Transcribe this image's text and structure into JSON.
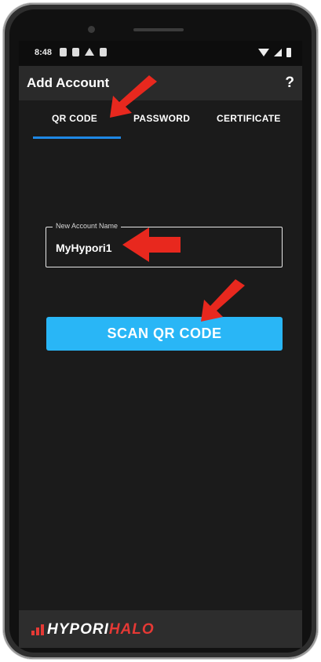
{
  "status_bar": {
    "time": "8:48"
  },
  "app_bar": {
    "title": "Add Account",
    "help_label": "?"
  },
  "tabs": [
    {
      "label": "QR CODE",
      "selected": true
    },
    {
      "label": "PASSWORD",
      "selected": false
    },
    {
      "label": "CERTIFICATE",
      "selected": false
    }
  ],
  "account_name_field": {
    "label": "New Account Name",
    "value": "MyHypori1"
  },
  "scan_button": {
    "label": "SCAN QR CODE"
  },
  "footer": {
    "logo_part1": "HYPORI",
    "logo_part2": "HALO"
  },
  "colors": {
    "accent": "#29b6f6",
    "tab_indicator": "#1e88e5",
    "annotation_arrow": "#e8281e",
    "brand_red": "#e53935"
  },
  "icons": [
    "wifi-icon",
    "signal-icon",
    "battery-icon",
    "help-icon",
    "arrow-annotation-icon",
    "hypori-logo-icon"
  ]
}
